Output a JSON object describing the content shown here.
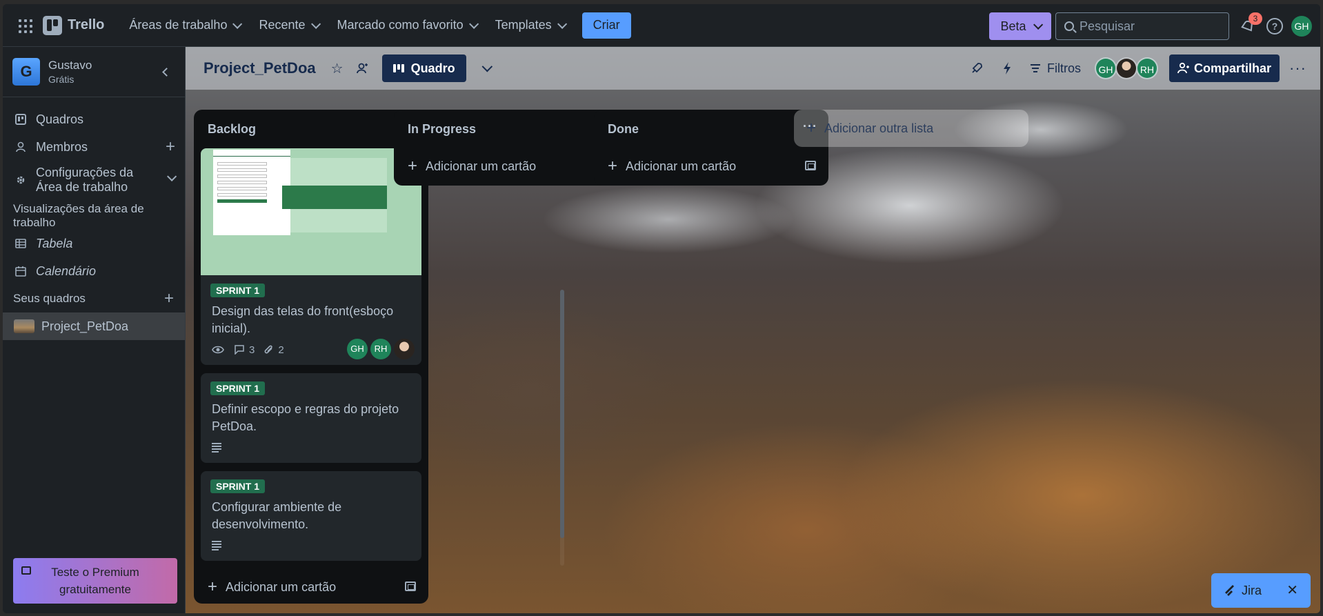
{
  "topbar": {
    "logo": "Trello",
    "nav": [
      {
        "label": "Áreas de trabalho"
      },
      {
        "label": "Recente"
      },
      {
        "label": "Marcado como favorito"
      },
      {
        "label": "Templates"
      }
    ],
    "create_label": "Criar",
    "beta_label": "Beta",
    "search_placeholder": "Pesquisar",
    "notification_count": "3",
    "help_symbol": "?",
    "user_initials": "GH"
  },
  "sidebar": {
    "workspace_initial": "G",
    "workspace_name": "Gustavo",
    "workspace_plan": "Grátis",
    "items": [
      {
        "label": "Quadros"
      },
      {
        "label": "Membros"
      },
      {
        "label": "Configurações da Área de trabalho"
      }
    ],
    "views_heading": "Visualizações da área de trabalho",
    "views": [
      {
        "label": "Tabela"
      },
      {
        "label": "Calendário"
      }
    ],
    "boards_heading": "Seus quadros",
    "boards": [
      {
        "label": "Project_PetDoa"
      }
    ],
    "premium_label": "Teste o Premium gratuitamente"
  },
  "board": {
    "title": "Project_PetDoa",
    "view_label": "Quadro",
    "filters_label": "Filtros",
    "members": [
      "GH",
      "",
      "RH"
    ],
    "share_label": "Compartilhar",
    "more": "···"
  },
  "lists": [
    {
      "title": "Backlog",
      "cards": [
        {
          "label": "SPRINT 1",
          "title": "Design das telas do front(esboço inicial).",
          "has_cover": true,
          "watching": true,
          "comments": "3",
          "attachments": "2",
          "members": [
            "GH",
            "RH",
            ""
          ]
        },
        {
          "label": "SPRINT 1",
          "title": "Definir escopo e regras do projeto PetDoa.",
          "has_description": true
        },
        {
          "label": "SPRINT 1",
          "title": "Configurar ambiente de desenvolvimento.",
          "has_description": true
        }
      ],
      "add_card_label": "Adicionar um cartão"
    },
    {
      "title": "In Progress",
      "cards": [],
      "add_card_label": "Adicionar um cartão"
    },
    {
      "title": "Done",
      "cards": [],
      "add_card_label": "Adicionar um cartão"
    }
  ],
  "add_list_label": "Adicionar outra lista",
  "jira_label": "Jira",
  "colors": {
    "accent_blue": "#579dff",
    "beta_purple": "#9f8fef",
    "label_green": "#216e4e",
    "avatar_green": "#1f845a",
    "badge_red": "#f87168"
  }
}
